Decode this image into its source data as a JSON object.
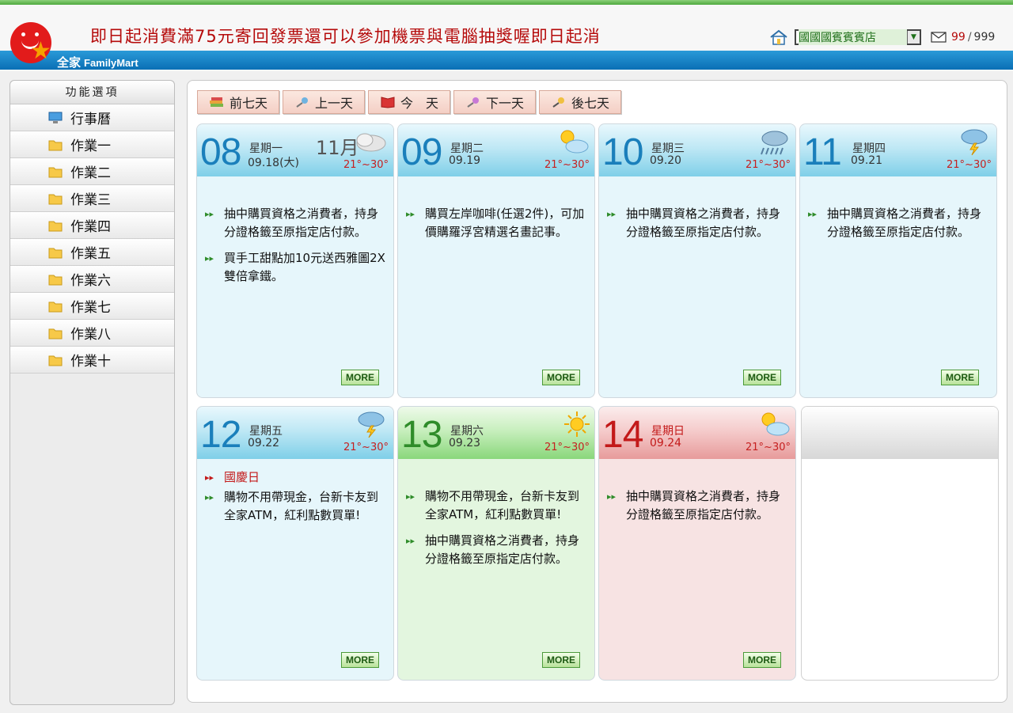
{
  "header": {
    "brand": "全家",
    "brand_en": "FamilyMart",
    "marquee": "即日起消費滿75元寄回發票還可以參加機票與電腦抽獎喔即日起消",
    "store": "國國國賓賓賓店",
    "mail_count": "99",
    "mail_sep": "/",
    "mail_total": "999"
  },
  "sidebar": {
    "title": "功能選項",
    "items": [
      {
        "label": "行事曆",
        "icon": "monitor-icon"
      },
      {
        "label": "作業一",
        "icon": "folder-icon"
      },
      {
        "label": "作業二",
        "icon": "folder-icon"
      },
      {
        "label": "作業三",
        "icon": "folder-icon"
      },
      {
        "label": "作業四",
        "icon": "folder-icon"
      },
      {
        "label": "作業五",
        "icon": "folder-icon"
      },
      {
        "label": "作業六",
        "icon": "folder-icon"
      },
      {
        "label": "作業七",
        "icon": "folder-icon"
      },
      {
        "label": "作業八",
        "icon": "folder-icon"
      },
      {
        "label": "作業十",
        "icon": "folder-icon"
      }
    ]
  },
  "nav": {
    "prev7": "前七天",
    "prev1": "上一天",
    "today": "今　天",
    "next1": "下一天",
    "next7": "後七天"
  },
  "days": [
    {
      "num": "08",
      "weekday": "星期一",
      "date": "09.18(大)",
      "month": "11月",
      "temp": "21°~30°",
      "weather": "cloudy",
      "events": [
        "抽中購買資格之消費者，持身分證格籤至原指定店付款。",
        "買手工甜點加10元送西雅圖2X雙倍拿鐵。"
      ],
      "more": "MORE"
    },
    {
      "num": "09",
      "weekday": "星期二",
      "date": "09.19",
      "temp": "21°~30°",
      "weather": "sunny-cloudy",
      "events": [
        "購買左岸咖啡(任選2件)，可加價購羅浮宮精選名畫記事。"
      ],
      "more": "MORE"
    },
    {
      "num": "10",
      "weekday": "星期三",
      "date": "09.20",
      "temp": "21°~30°",
      "weather": "rain",
      "events": [
        "抽中購買資格之消費者，持身分證格籤至原指定店付款。"
      ],
      "more": "MORE"
    },
    {
      "num": "11",
      "weekday": "星期四",
      "date": "09.21",
      "temp": "21°~30°",
      "weather": "thunder",
      "events": [
        "抽中購買資格之消費者，持身分證格籤至原指定店付款。"
      ],
      "more": "MORE"
    },
    {
      "num": "12",
      "weekday": "星期五",
      "date": "09.22",
      "temp": "21°~30°",
      "weather": "thunder",
      "holiday": "國慶日",
      "events": [
        "購物不用帶現金，台新卡友到全家ATM，紅利點數買單!"
      ],
      "more": "MORE"
    },
    {
      "num": "13",
      "weekday": "星期六",
      "date": "09.23",
      "temp": "21°~30°",
      "weather": "sunny",
      "events": [
        "購物不用帶現金，台新卡友到全家ATM，紅利點數買單!",
        "抽中購買資格之消費者，持身分證格籤至原指定店付款。"
      ],
      "more": "MORE"
    },
    {
      "num": "14",
      "weekday": "星期日",
      "date": "09.24",
      "temp": "21°~30°",
      "weather": "sunny-cloudy",
      "events": [
        "抽中購買資格之消費者，持身分證格籤至原指定店付款。"
      ],
      "more": "MORE"
    }
  ]
}
